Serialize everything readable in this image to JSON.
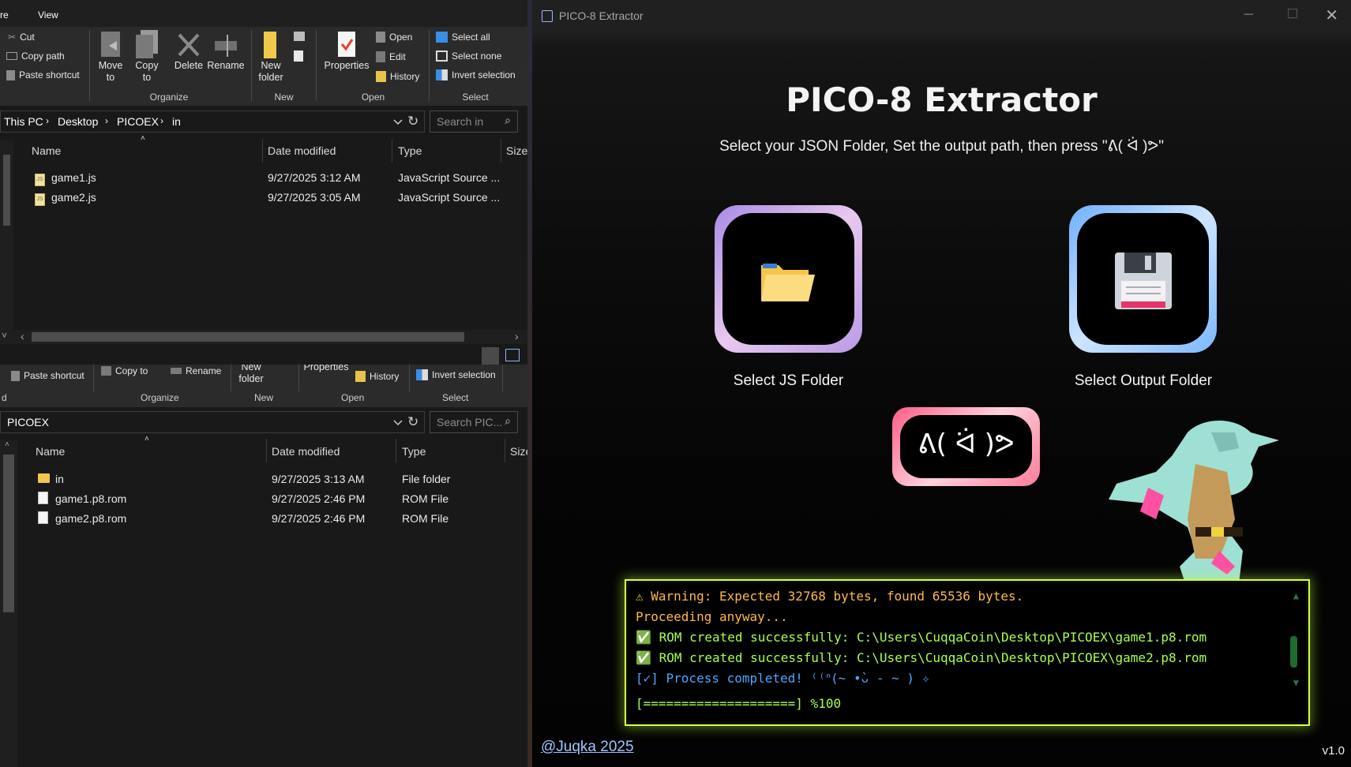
{
  "explorer_top": {
    "menu": {
      "left_fragment": "re",
      "view": "View"
    },
    "ribbon": {
      "clipboard": {
        "cut": "Cut",
        "copy_path": "Copy path",
        "paste_shortcut": "Paste shortcut"
      },
      "organize": {
        "move_to": "Move to",
        "copy_to": "Copy to",
        "delete": "Delete",
        "rename": "Rename",
        "label": "Organize"
      },
      "new": {
        "new_folder": "New folder",
        "label": "New"
      },
      "open": {
        "properties": "Properties",
        "open": "Open",
        "edit": "Edit",
        "history": "History",
        "label": "Open"
      },
      "select": {
        "select_all": "Select all",
        "select_none": "Select none",
        "invert": "Invert selection",
        "label": "Select"
      }
    },
    "breadcrumb": [
      "This PC",
      "Desktop",
      "PICOEX",
      "in"
    ],
    "search_placeholder": "Search in",
    "columns": {
      "name": "Name",
      "date": "Date modified",
      "type": "Type",
      "size": "Size"
    },
    "files": [
      {
        "name": "game1.js",
        "date": "9/27/2025 3:12 AM",
        "type": "JavaScript Source ..."
      },
      {
        "name": "game2.js",
        "date": "9/27/2025 3:05 AM",
        "type": "JavaScript Source ..."
      }
    ]
  },
  "explorer_bottom": {
    "ribbon": {
      "paste_shortcut": "Paste shortcut",
      "copy_to": "Copy to",
      "rename": "Rename",
      "new_folder": "New folder",
      "properties": "Properties",
      "history": "History",
      "invert": "Invert selection",
      "organize_label": "Organize",
      "new_label": "New",
      "open_label": "Open",
      "select_label": "Select",
      "left_label": "d"
    },
    "breadcrumb": [
      "PICOEX"
    ],
    "search_placeholder": "Search PIC...",
    "columns": {
      "name": "Name",
      "date": "Date modified",
      "type": "Type",
      "size": "Size"
    },
    "files": [
      {
        "name": "in",
        "date": "9/27/2025 3:13 AM",
        "type": "File folder",
        "icon": "folder-icon"
      },
      {
        "name": "game1.p8.rom",
        "date": "9/27/2025 2:46 PM",
        "type": "ROM File",
        "icon": "file-icon"
      },
      {
        "name": "game2.p8.rom",
        "date": "9/27/2025 2:46 PM",
        "type": "ROM File",
        "icon": "file-icon"
      }
    ]
  },
  "extractor": {
    "window_title": "PICO-8 Extractor",
    "title": "PICO-8 Extractor",
    "subtitle": "Select your JSON Folder, Set the output path, then press \"ᕕ( ᐛ )ᕗ\"",
    "select_js_label": "Select JS Folder",
    "select_output_label": "Select Output Folder",
    "run_button": "ᕕ( ᐛ )ᕗ",
    "colors": {
      "console_border": "#d6ff4a",
      "warning": "#ffb84a",
      "success": "#a6ff4d",
      "complete": "#4da6ff"
    },
    "console": [
      {
        "icon": "⚠",
        "text": "Warning: Expected 32768 bytes, found 65536 bytes."
      },
      {
        "icon": "",
        "text": "Proceeding anyway..."
      },
      {
        "icon": "✅",
        "text": "ROM created successfully: C:\\Users\\CuqqaCoin\\Desktop\\PICOEX\\game1.p8.rom"
      },
      {
        "icon": "✅",
        "text": "ROM created successfully: C:\\Users\\CuqqaCoin\\Desktop\\PICOEX\\game2.p8.rom"
      },
      {
        "icon": "",
        "text": "[✓] Process completed! ⁽⁽ᐢ(~ •̀ᴗ - ~ ) ✧"
      },
      {
        "icon": "",
        "text": "[====================] %100"
      }
    ],
    "progress": 100,
    "credit": "@Juqka 2025",
    "version": "v1.0"
  }
}
